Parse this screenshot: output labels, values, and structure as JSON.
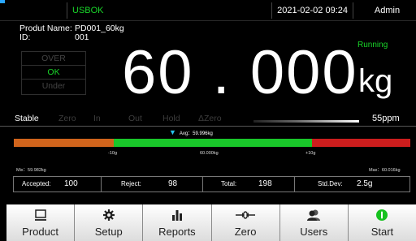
{
  "topbar": {
    "connection_status": "USBOK",
    "datetime": "2021-02-02 09:24",
    "user": "Admin"
  },
  "product": {
    "name_label": "Produt Name:",
    "name": "PD001_60kg",
    "id_label": "ID:",
    "id": "001"
  },
  "status_indicators": [
    {
      "label": "OVER",
      "active": false
    },
    {
      "label": "OK",
      "active": true
    },
    {
      "label": "Under",
      "active": false
    }
  ],
  "run_state": "Running",
  "weight": {
    "value": "60 . 000",
    "unit": "kg"
  },
  "flags": [
    {
      "label": "Stable",
      "active": true
    },
    {
      "label": "Zero",
      "active": false
    },
    {
      "label": "In",
      "active": false
    },
    {
      "label": "Out",
      "active": false
    },
    {
      "label": "Hold",
      "active": false
    },
    {
      "label": "ΔZero",
      "active": false
    }
  ],
  "speed": "55ppm",
  "gauge": {
    "avg_label": "Avg：59.996kg",
    "lower_tol": "-10g",
    "target": "60.000kg",
    "upper_tol": "+10g",
    "min_label": "Mix：59.982kg",
    "max_label": "Max：60.016kg",
    "colors": {
      "low": "#d0641c",
      "ok": "#19c72a",
      "high": "#cc1d1d"
    }
  },
  "stats": {
    "accepted_label": "Accepted:",
    "accepted": "100",
    "reject_label": "Reject:",
    "reject": "98",
    "total_label": "Total:",
    "total": "198",
    "stddev_label": "Std.Dev:",
    "stddev": "2.5g"
  },
  "toolbar": {
    "product": "Product",
    "setup": "Setup",
    "reports": "Reports",
    "zero": "Zero",
    "users": "Users",
    "start": "Start"
  },
  "colors": {
    "accent_green": "#19d629",
    "avg_marker": "#27c4ee",
    "background": "#000000"
  },
  "icons": [
    "product-icon",
    "gear-icon",
    "bar-chart-icon",
    "zero-arrows-icon",
    "users-icon",
    "power-icon"
  ]
}
